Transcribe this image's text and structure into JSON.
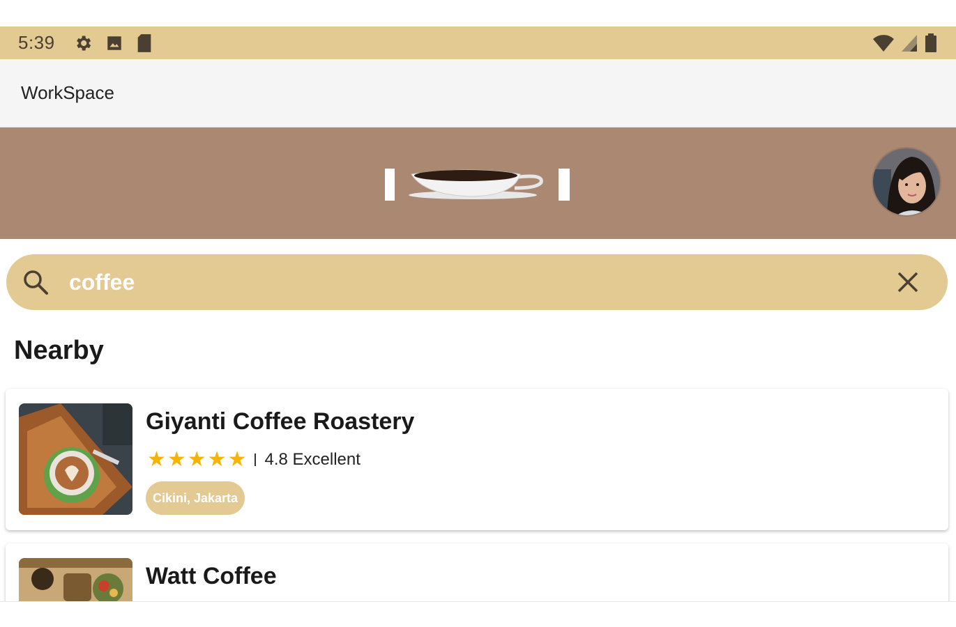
{
  "status_bar": {
    "time": "5:39",
    "left_icons": [
      "gear-icon",
      "photo-icon",
      "sd-card-icon"
    ],
    "right_icons": [
      "wifi-icon",
      "signal-icon",
      "battery-icon"
    ]
  },
  "app_bar": {
    "title": "WorkSpace"
  },
  "banner": {
    "logo": "coffee-cup-logo",
    "avatar": "user-avatar"
  },
  "search": {
    "value": "coffee",
    "placeholder": ""
  },
  "section": {
    "title": "Nearby"
  },
  "places": [
    {
      "name": "Giyanti Coffee Roastery",
      "stars": "★★★★★",
      "rating": "4.8 Excellent",
      "location": "Cikini, Jakarta"
    },
    {
      "name": "Watt Coffee"
    }
  ],
  "colors": {
    "accent": "#e3c992",
    "banner": "#ab8872",
    "star": "#f5b400"
  }
}
